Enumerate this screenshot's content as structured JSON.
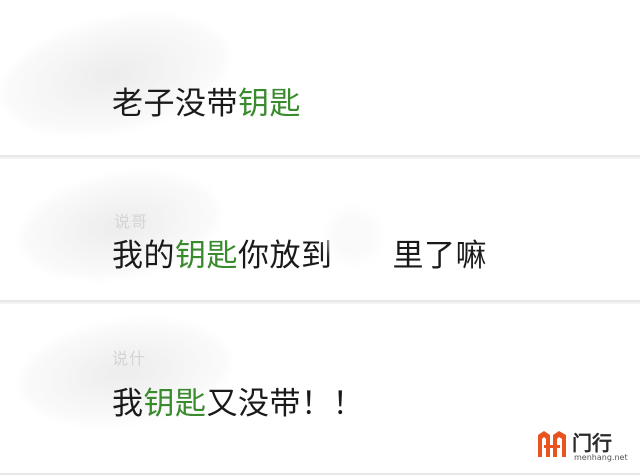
{
  "messages": [
    {
      "parts": [
        "老子没带",
        "钥匙",
        ""
      ]
    },
    {
      "parts": [
        "我的",
        "钥匙",
        "你放到",
        "里了嘛"
      ]
    },
    {
      "parts": [
        "我",
        "钥匙",
        "又没带！！"
      ]
    }
  ],
  "faint_names": [
    "说哥",
    "说什"
  ],
  "watermark": {
    "title": "门行",
    "subtitle": "menhang.net"
  },
  "colors": {
    "highlight": "#3a8a2e",
    "text": "#1a1a1a",
    "watermark_orange": "#e8531f"
  }
}
